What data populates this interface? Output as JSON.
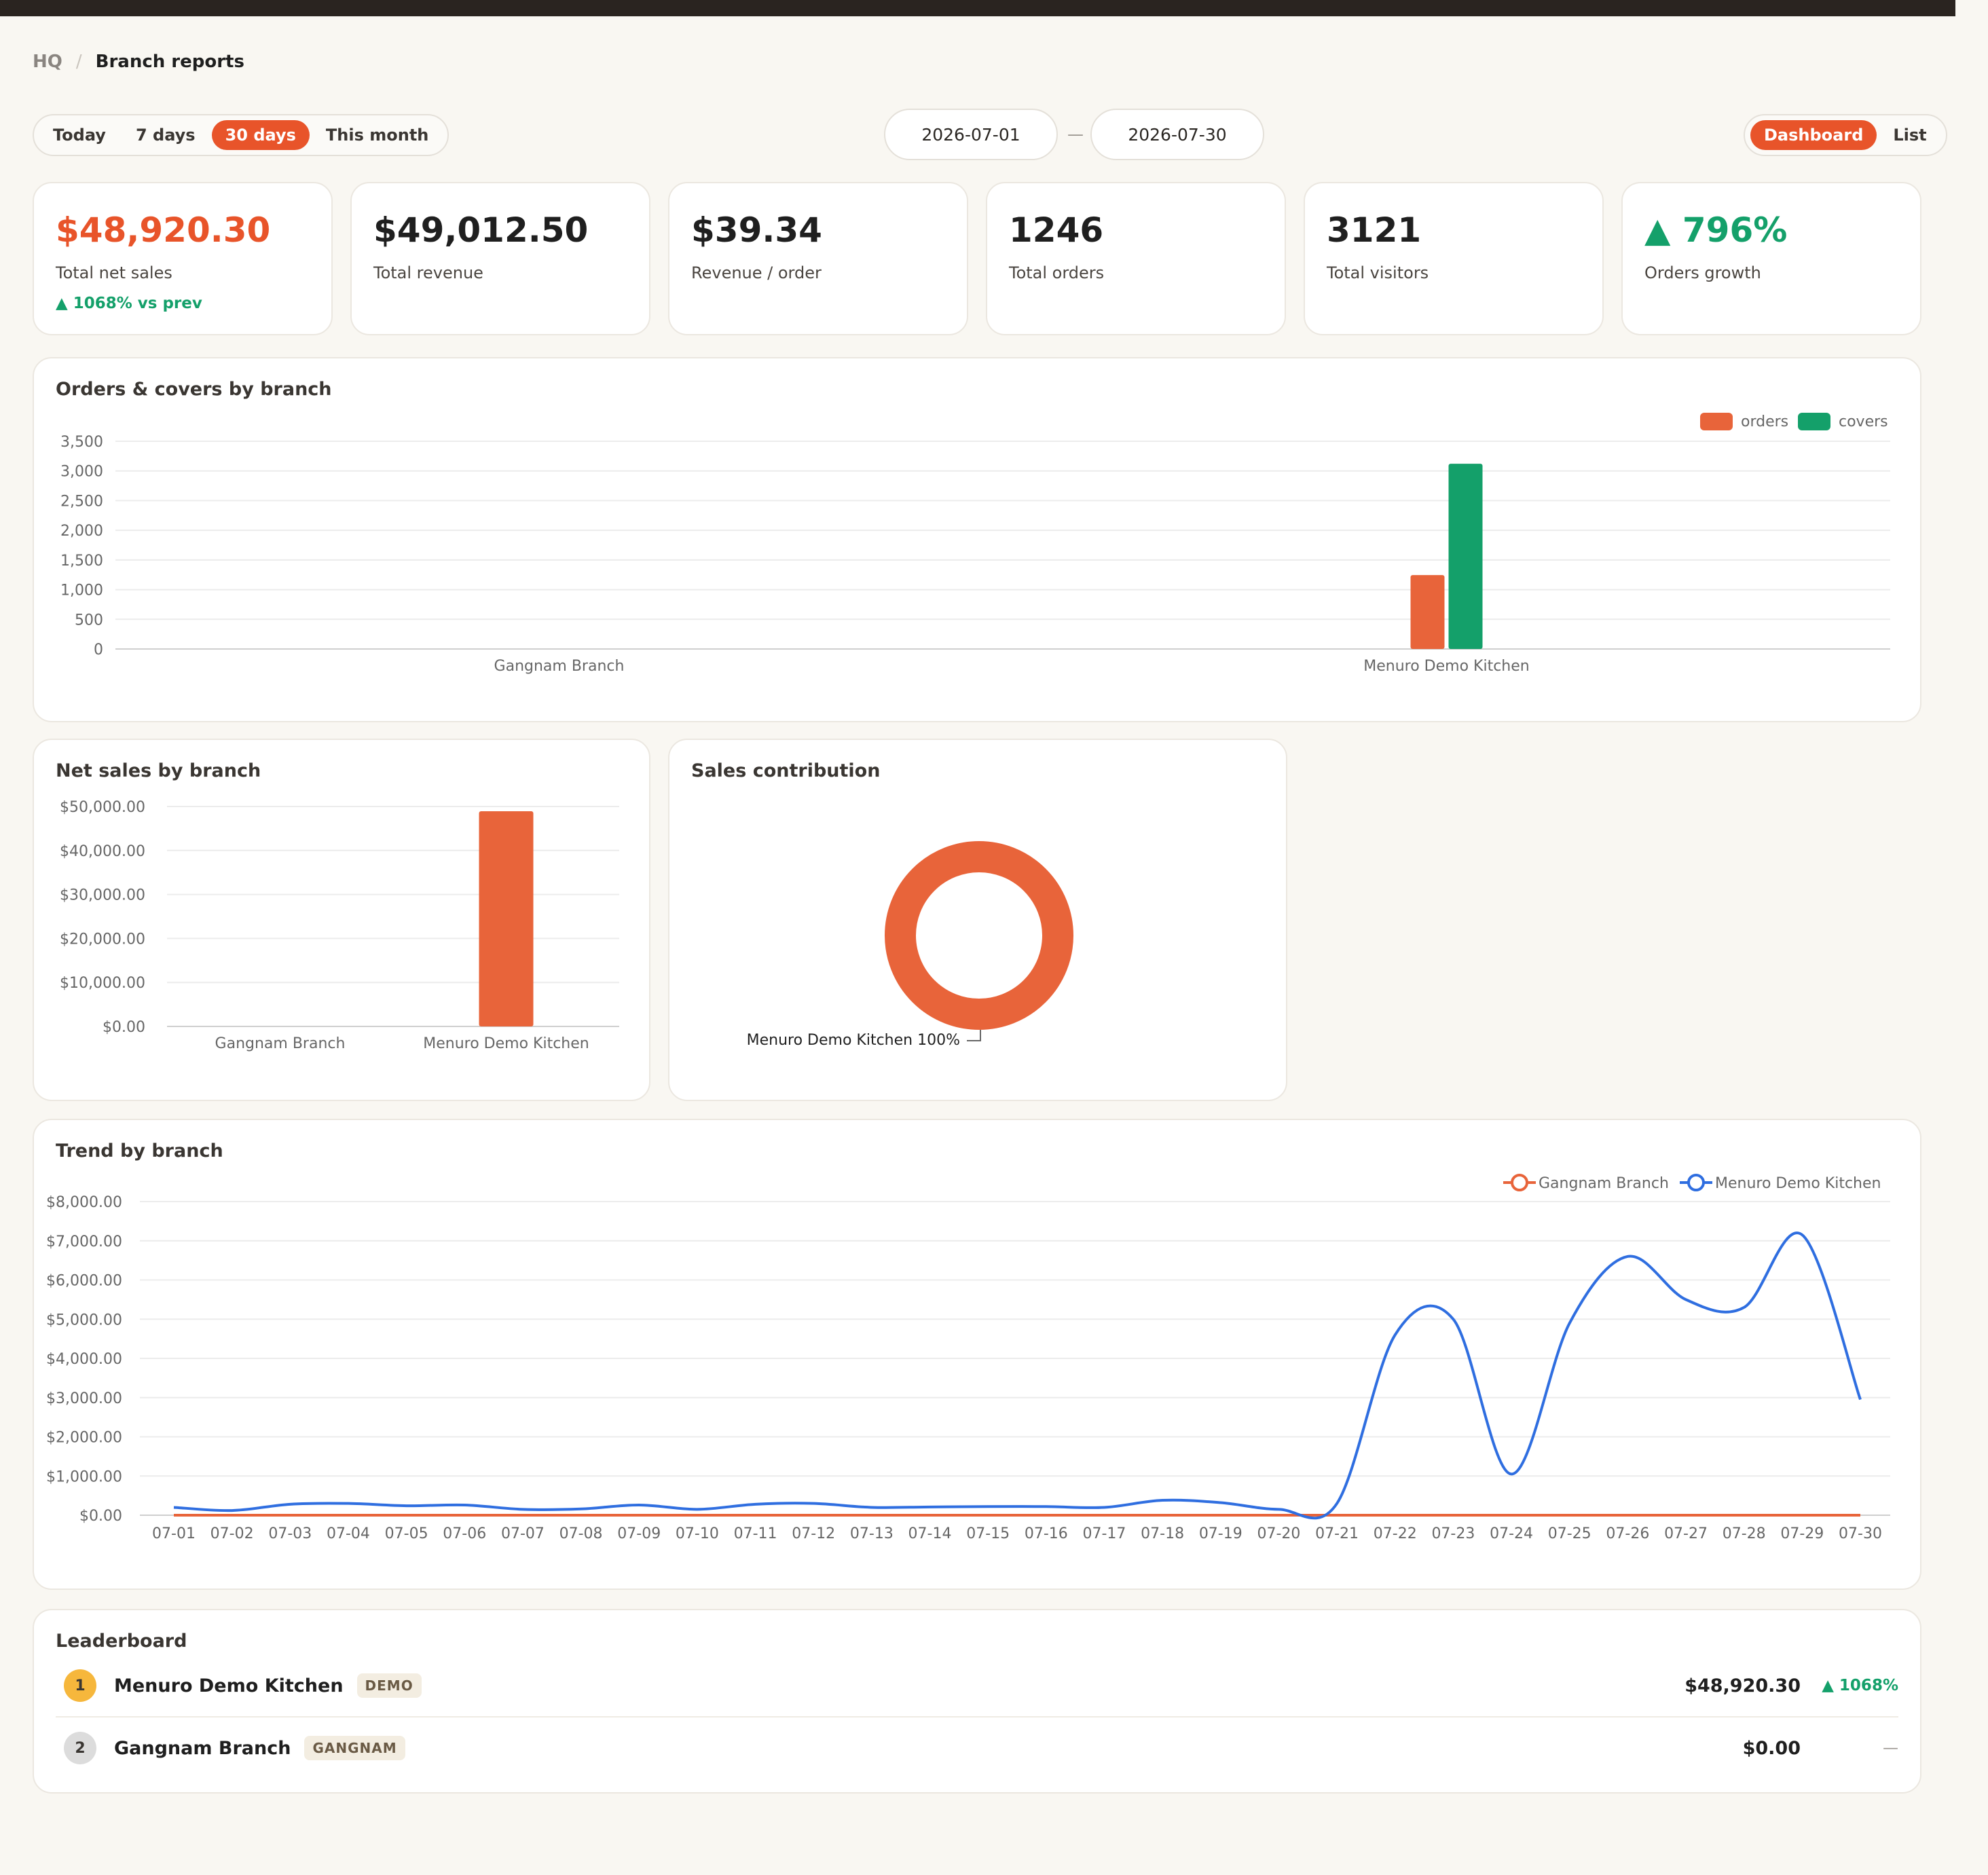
{
  "breadcrumb": {
    "root": "HQ",
    "separator": "/",
    "current": "Branch reports"
  },
  "range_tabs": [
    {
      "label": "Today",
      "active": false
    },
    {
      "label": "7 days",
      "active": false
    },
    {
      "label": "30 days",
      "active": true
    },
    {
      "label": "This month",
      "active": false
    }
  ],
  "date_range": {
    "start": "2026-07-01",
    "separator": "—",
    "end": "2026-07-30"
  },
  "view_tabs": [
    {
      "label": "Dashboard",
      "active": true
    },
    {
      "label": "List",
      "active": false
    }
  ],
  "kpis": [
    {
      "value": "$48,920.30",
      "label": "Total net sales",
      "delta": "▲ 1068% vs prev"
    },
    {
      "value": "$49,012.50",
      "label": "Total revenue"
    },
    {
      "value": "$39.34",
      "label": "Revenue / order"
    },
    {
      "value": "1246",
      "label": "Total orders"
    },
    {
      "value": "3121",
      "label": "Total visitors"
    },
    {
      "value": "▲ 796%",
      "label": "Orders growth"
    }
  ],
  "colors": {
    "accent": "#e8542a",
    "orders": "#e8643a",
    "covers": "#14a06a",
    "trend_gangnam": "#e8643a",
    "trend_menuro": "#2f6ee0",
    "positive": "#14a06a"
  },
  "chart_data": [
    {
      "type": "bar",
      "title": "Orders & covers by branch",
      "categories": [
        "Gangnam Branch",
        "Menuro Demo Kitchen"
      ],
      "series": [
        {
          "name": "orders",
          "values": [
            0,
            1246
          ]
        },
        {
          "name": "covers",
          "values": [
            0,
            3121
          ]
        }
      ],
      "yticks": [
        "0",
        "500",
        "1,000",
        "1,500",
        "2,000",
        "2,500",
        "3,000",
        "3,500"
      ],
      "ylim": [
        0,
        3500
      ],
      "grid": true,
      "legend": "top-right"
    },
    {
      "type": "bar",
      "title": "Net sales by branch",
      "categories": [
        "Gangnam Branch",
        "Menuro Demo Kitchen"
      ],
      "series": [
        {
          "values": [
            0,
            48920.3
          ]
        }
      ],
      "yticks": [
        "$0.00",
        "$10,000.00",
        "$20,000.00",
        "$30,000.00",
        "$40,000.00",
        "$50,000.00"
      ],
      "ylim": [
        0,
        50000
      ],
      "grid": true
    },
    {
      "type": "pie",
      "title": "Sales contribution",
      "slices": [
        {
          "label": "Menuro Demo Kitchen",
          "value": 100,
          "display": "100%"
        }
      ]
    },
    {
      "type": "line",
      "title": "Trend by branch",
      "x": [
        "07-01",
        "07-02",
        "07-03",
        "07-04",
        "07-05",
        "07-06",
        "07-07",
        "07-08",
        "07-09",
        "07-10",
        "07-11",
        "07-12",
        "07-13",
        "07-14",
        "07-15",
        "07-16",
        "07-17",
        "07-18",
        "07-19",
        "07-20",
        "07-21",
        "07-22",
        "07-23",
        "07-24",
        "07-25",
        "07-26",
        "07-27",
        "07-28",
        "07-29",
        "07-30"
      ],
      "series": [
        {
          "name": "Gangnam Branch",
          "values": [
            0,
            0,
            0,
            0,
            0,
            0,
            0,
            0,
            0,
            0,
            0,
            0,
            0,
            0,
            0,
            0,
            0,
            0,
            0,
            0,
            0,
            0,
            0,
            0,
            0,
            0,
            0,
            0,
            0,
            0
          ]
        },
        {
          "name": "Menuro Demo Kitchen",
          "values": [
            200,
            120,
            280,
            300,
            240,
            260,
            150,
            160,
            260,
            150,
            280,
            300,
            200,
            210,
            220,
            220,
            200,
            380,
            320,
            150,
            300,
            4600,
            5000,
            1050,
            4900,
            6600,
            5500,
            5300,
            7150,
            2950
          ]
        }
      ],
      "yticks": [
        "$0.00",
        "$1,000.00",
        "$2,000.00",
        "$3,000.00",
        "$4,000.00",
        "$5,000.00",
        "$6,000.00",
        "$7,000.00",
        "$8,000.00"
      ],
      "ylim": [
        0,
        8000
      ],
      "grid": true,
      "legend": "top-right"
    }
  ],
  "leaderboard": {
    "title": "Leaderboard",
    "rows": [
      {
        "rank": "1",
        "name": "Menuro Demo Kitchen",
        "tag": "DEMO",
        "amount": "$48,920.30",
        "delta": "▲ 1068%"
      },
      {
        "rank": "2",
        "name": "Gangnam Branch",
        "tag": "GANGNAM",
        "amount": "$0.00",
        "delta": "—"
      }
    ]
  }
}
